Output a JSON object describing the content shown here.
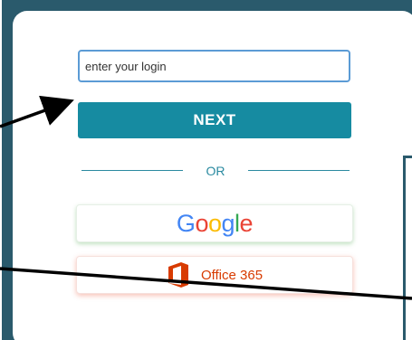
{
  "login": {
    "placeholder": "enter your login",
    "next_label": "NEXT"
  },
  "divider": {
    "text": "OR"
  },
  "providers": {
    "google": {
      "letters": [
        "G",
        "o",
        "o",
        "g",
        "l",
        "e"
      ],
      "colors": [
        "#4285F4",
        "#EA4335",
        "#FBBC05",
        "#4285F4",
        "#34A853",
        "#EA4335"
      ]
    },
    "office": {
      "label": "Office 365",
      "icon": "office-logo-icon",
      "color": "#D83B01"
    }
  },
  "colors": {
    "accent": "#168BA1",
    "frame": "#2A5A6C",
    "input_border": "#5B9BD5"
  }
}
